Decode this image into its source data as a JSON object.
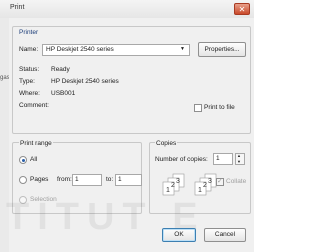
{
  "window": {
    "title": "Print",
    "close_glyph": "✕"
  },
  "background": {
    "left_fragment": "gas"
  },
  "printer": {
    "group_label": "Printer",
    "name_label": "Name:",
    "name_value": "HP Deskjet 2540 series",
    "properties_label": "Properties...",
    "status_label": "Status:",
    "status_value": "Ready",
    "type_label": "Type:",
    "type_value": "HP Deskjet 2540 series",
    "where_label": "Where:",
    "where_value": "USB001",
    "comment_label": "Comment:",
    "print_to_file_label": "Print to file",
    "print_to_file_checked": false
  },
  "print_range": {
    "group_label": "Print range",
    "all_label": "All",
    "pages_label": "Pages",
    "from_label": "from:",
    "from_value": "1",
    "to_label": "to:",
    "to_value": "1",
    "selection_label": "Selection",
    "selected": "all"
  },
  "copies": {
    "group_label": "Copies",
    "number_label": "Number of copies:",
    "number_value": "1",
    "collate_label": "Collate",
    "collate_checked": true
  },
  "buttons": {
    "ok": "OK",
    "cancel": "Cancel"
  },
  "watermark": "TITUT E",
  "colors": {
    "close": "#c9492a",
    "radio_dot": "#2a5fa8"
  }
}
